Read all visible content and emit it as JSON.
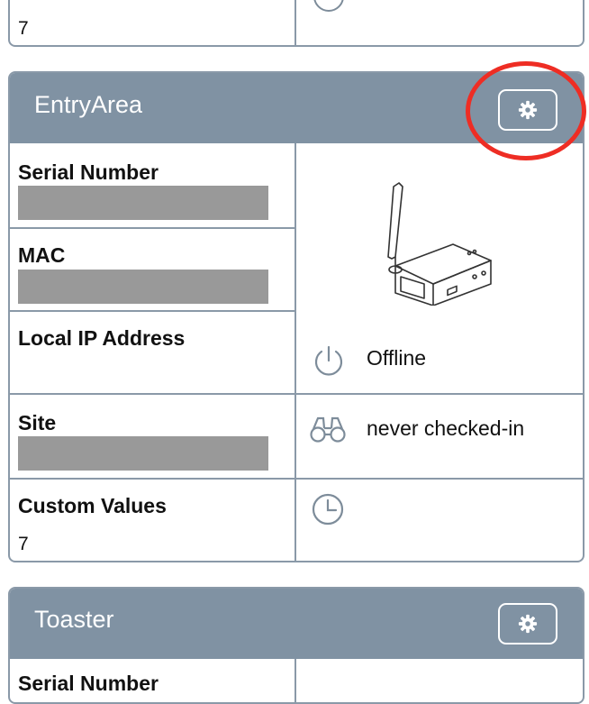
{
  "top_card": {
    "custom_values_value": "7"
  },
  "entry_card": {
    "title": "EntryArea",
    "settings_icon": "gear-icon",
    "fields": {
      "serial_number_label": "Serial Number",
      "mac_label": "MAC",
      "local_ip_label": "Local IP Address",
      "site_label": "Site",
      "custom_values_label": "Custom Values",
      "custom_values_value": "7"
    },
    "status": {
      "online_state": "Offline",
      "checkin": "never checked-in"
    },
    "device_image": "wifi-device-with-antenna"
  },
  "toaster_card": {
    "title": "Toaster",
    "settings_icon": "gear-icon",
    "serial_number_label": "Serial Number"
  },
  "colors": {
    "header": "#8092a3",
    "border": "#8a99a8",
    "redacted": "#999999",
    "highlight": "#ee2d24"
  }
}
